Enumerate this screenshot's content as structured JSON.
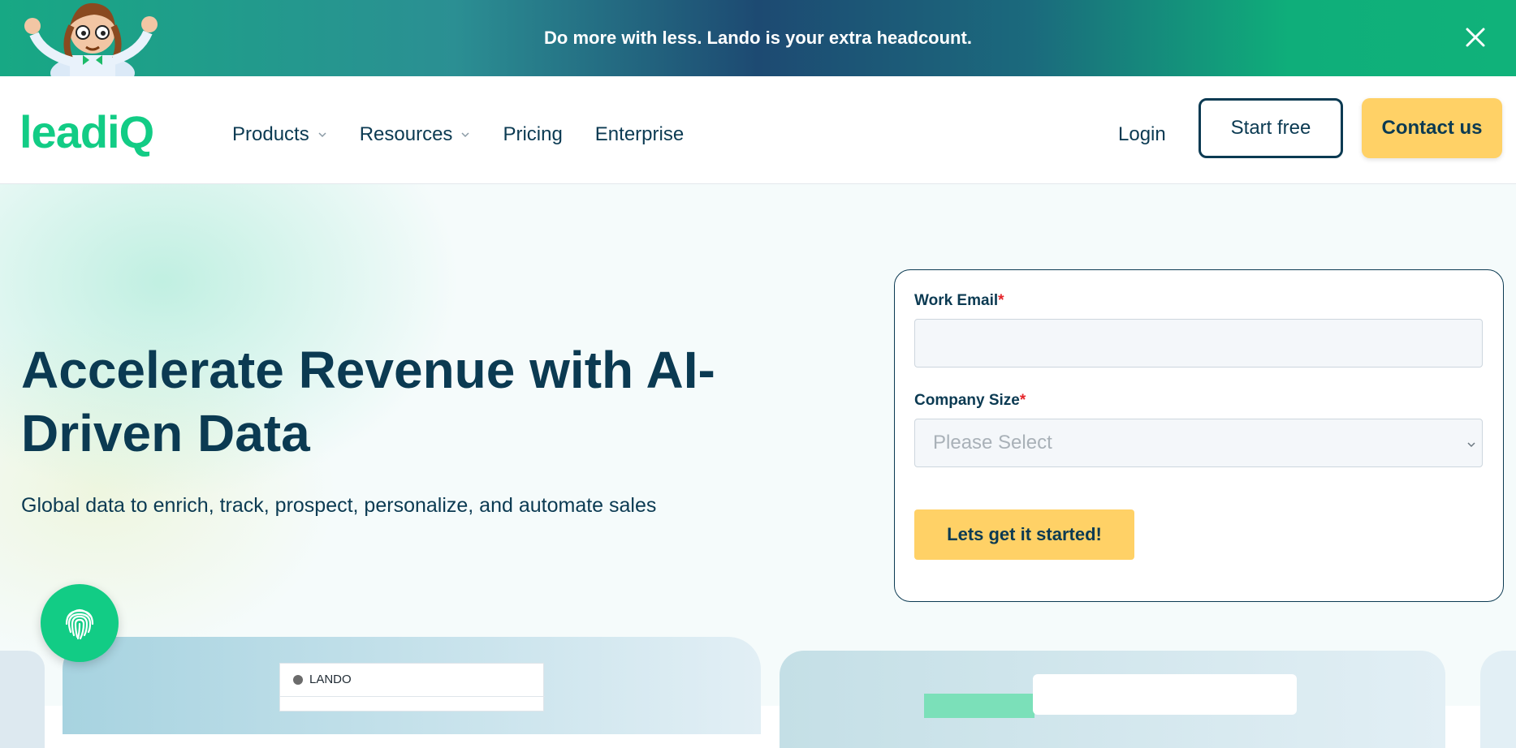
{
  "promo": {
    "text": "Do more with less. Lando is your extra headcount."
  },
  "header": {
    "logo": "leadiQ",
    "nav": [
      {
        "label": "Products",
        "has_dropdown": true
      },
      {
        "label": "Resources",
        "has_dropdown": true
      },
      {
        "label": "Pricing",
        "has_dropdown": false
      },
      {
        "label": "Enterprise",
        "has_dropdown": false
      }
    ],
    "login": "Login",
    "start_free": "Start free",
    "contact_us": "Contact us"
  },
  "hero": {
    "title": "Accelerate Revenue with AI-Driven Data",
    "subtitle": "Global data to enrich, track, prospect, personalize, and automate sales"
  },
  "form": {
    "email_label": "Work Email",
    "company_size_label": "Company Size",
    "required_mark": "*",
    "email_value": "",
    "company_size_placeholder": "Please Select",
    "submit_label": "Lets get it started!"
  },
  "preview": {
    "lando_label": "LANDO"
  },
  "colors": {
    "brand_green": "#12cc85",
    "navy": "#0b3a52",
    "cta_yellow": "#ffd166",
    "required_red": "#e5252a"
  },
  "icons": [
    "mascot-illustration",
    "close-icon",
    "chevron-down-icon",
    "fingerprint-icon"
  ]
}
